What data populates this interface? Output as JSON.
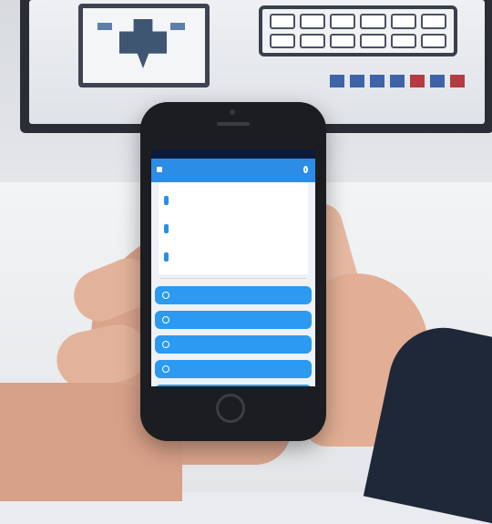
{
  "monitor": {
    "caption": "",
    "brand_text": "",
    "keys_count_label": ""
  },
  "phone": {
    "header": {
      "title": ""
    },
    "accounts": [
      {
        "label": "",
        "amount": "",
        "sub": ""
      },
      {
        "label": "",
        "amount": "",
        "sub": ""
      },
      {
        "label": "",
        "amount": "",
        "sub": ""
      }
    ],
    "total": {
      "label": "",
      "value": ""
    },
    "buttons": [
      {
        "label": ""
      },
      {
        "label": ""
      },
      {
        "label": ""
      },
      {
        "label": ""
      },
      {
        "label": ""
      }
    ]
  },
  "colors": {
    "primary": "#2b8de6",
    "button": "#2b9af0",
    "status_bar": "#0d1b3a",
    "phone_body": "#1b1d21",
    "sleeve": "#1e2838"
  },
  "icons": [
    "menu-icon",
    "refresh-icon",
    "account-icon",
    "home-button"
  ]
}
